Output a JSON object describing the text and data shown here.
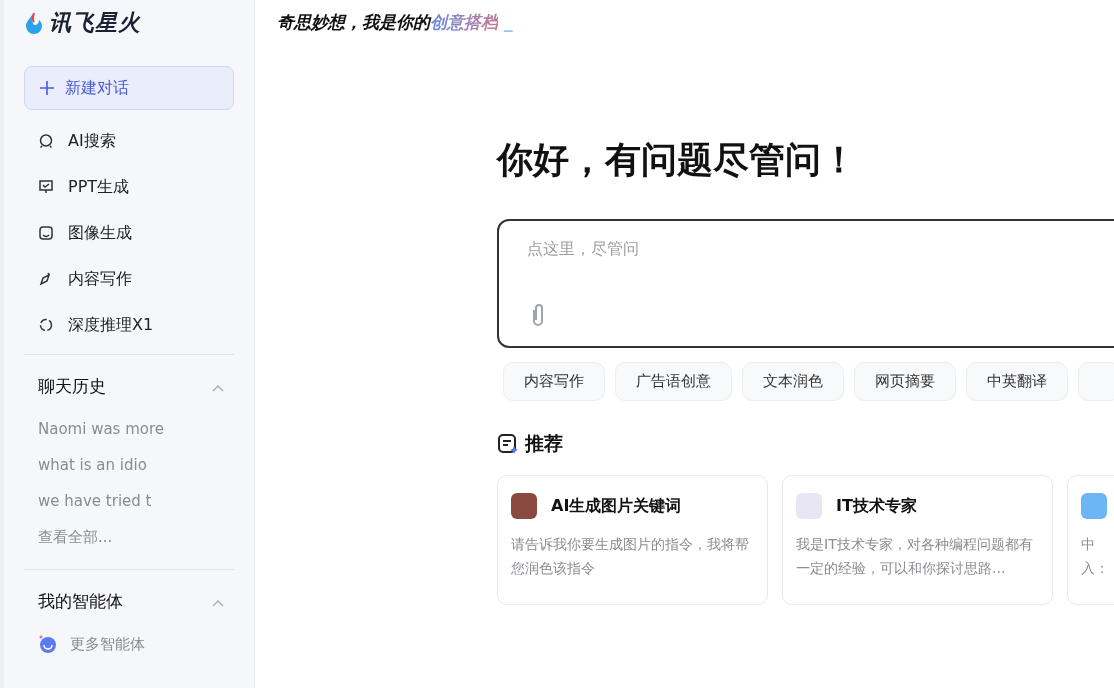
{
  "logo": {
    "text": "讯飞星火"
  },
  "tagline": {
    "text": "奇思妙想，我是你的",
    "highlight": "创意搭档",
    "cursor": "_"
  },
  "new_chat": {
    "label": "新建对话"
  },
  "nav": [
    {
      "kind": "search",
      "label": "AI搜索"
    },
    {
      "kind": "ppt",
      "label": "PPT生成"
    },
    {
      "kind": "image",
      "label": "图像生成"
    },
    {
      "kind": "write",
      "label": "内容写作"
    },
    {
      "kind": "reason",
      "label": "深度推理X1"
    }
  ],
  "history": {
    "title": "聊天历史",
    "expanded": true,
    "items": [
      "Naomi was more",
      "what is an idio",
      "we have tried t"
    ],
    "view_all": "查看全部..."
  },
  "agents": {
    "title": "我的智能体",
    "expanded": true,
    "items": [
      {
        "label": "更多智能体"
      }
    ]
  },
  "greeting": "你好，有问题尽管问！",
  "input": {
    "placeholder": "点这里，尽管问"
  },
  "chips": [
    "内容写作",
    "广告语创意",
    "文本润色",
    "网页摘要",
    "中英翻译"
  ],
  "chip_cut_off": true,
  "recommend": {
    "title": "推荐",
    "cards": [
      {
        "kind": "photo",
        "title": "AI生成图片关键词",
        "desc": "请告诉我你要生成图片的指令，我将帮您润色该指令"
      },
      {
        "kind": "person",
        "title": "IT技术专家",
        "desc": "我是IT技术专家，对各种编程问题都有一定的经验，可以和你探讨思路..."
      },
      {
        "kind": "translate",
        "desc_lines": [
          "中",
          "入："
        ]
      }
    ]
  }
}
